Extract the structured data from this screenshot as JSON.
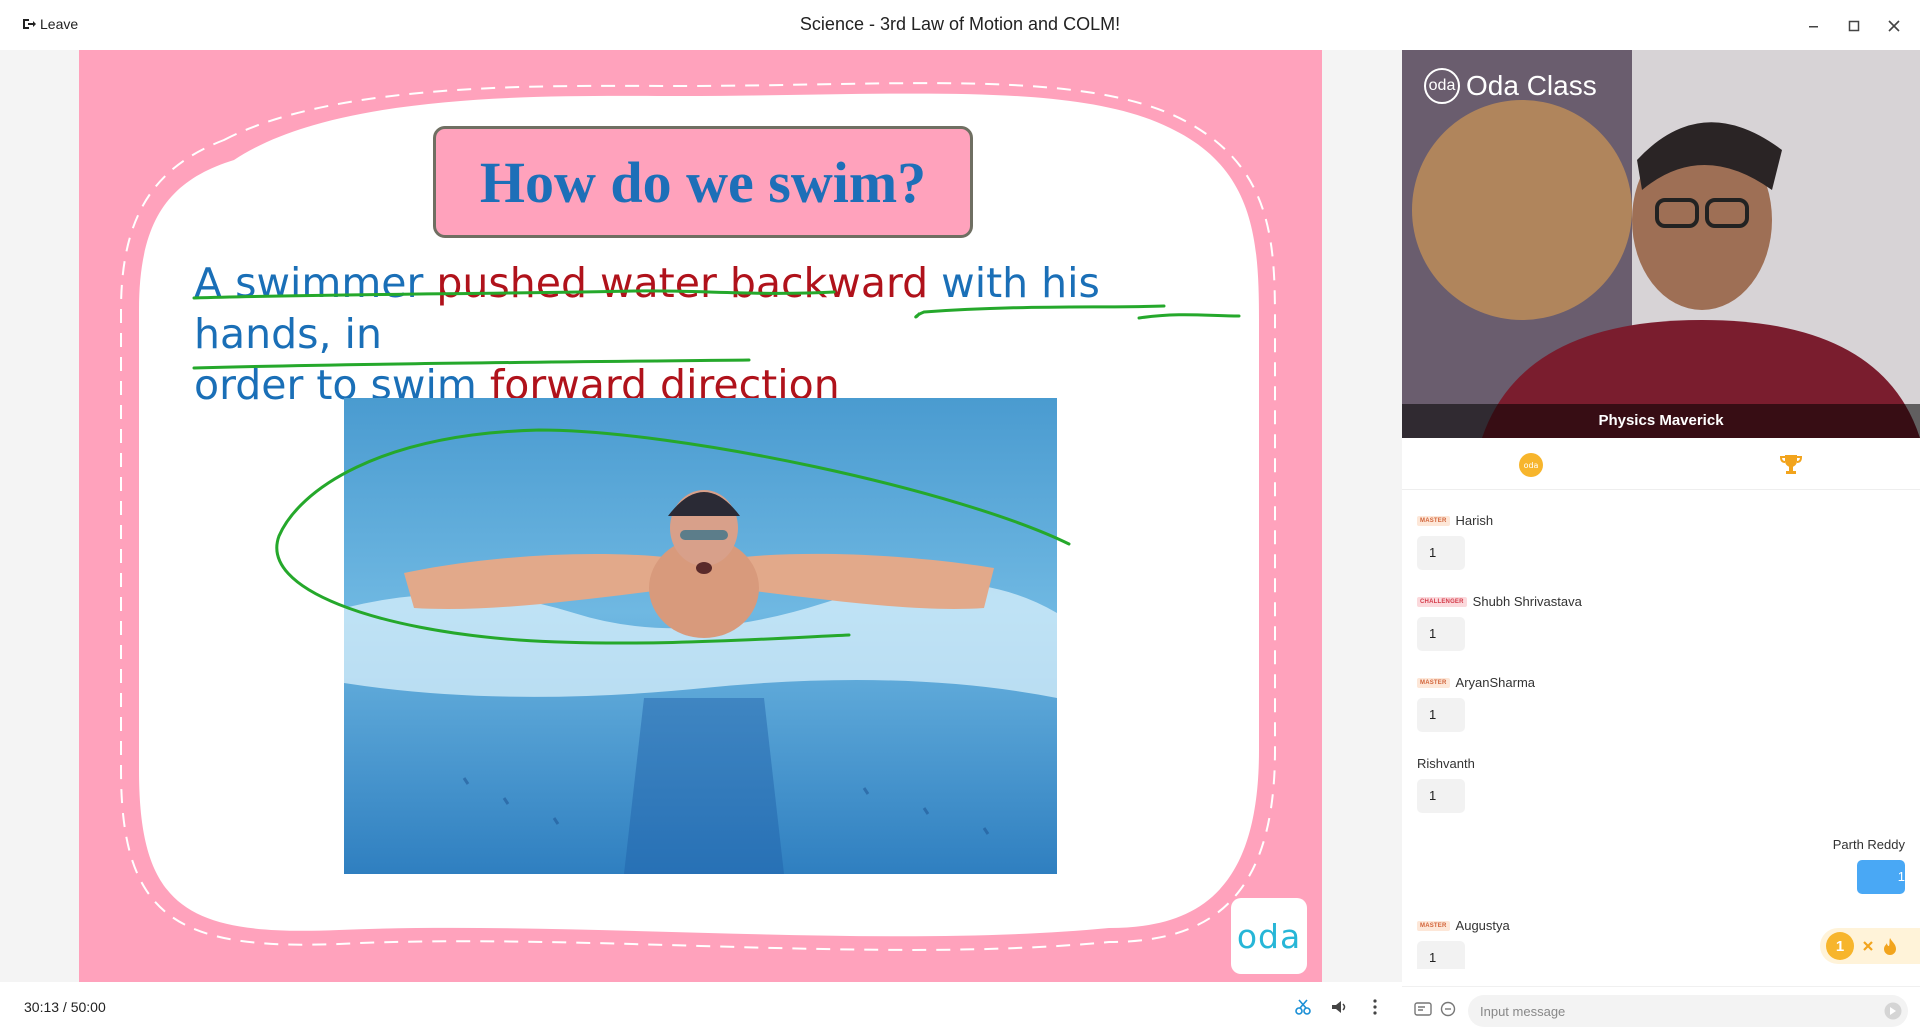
{
  "window": {
    "title": "Science - 3rd Law of Motion and COLM!",
    "leave_label": "Leave"
  },
  "slide": {
    "title": "How do we swim?",
    "body_segments": [
      {
        "text": "A ",
        "color": "#1a6fb7"
      },
      {
        "text": "swimmer ",
        "color": "#1a6fb7"
      },
      {
        "text": "pushed water backward ",
        "color": "#b0121b"
      },
      {
        "text": "with his hands, in",
        "color": "#1a6fb7"
      },
      {
        "text": "order to swim ",
        "color": "#1a6fb7"
      },
      {
        "text": "forward direction",
        "color": "#b0121b"
      }
    ],
    "badge_text": "oda",
    "ink_color": "#25a82b",
    "pink": "#ffa2bc"
  },
  "controls": {
    "timer": "30:13  / 50:00"
  },
  "video": {
    "brand": "Oda Class",
    "brand_mark": "oda",
    "presenter_name": "Physics Maverick"
  },
  "chat": {
    "messages": [
      {
        "rank": "MASTER",
        "name": "Harish",
        "text": "1"
      },
      {
        "rank": "CHALLENGER",
        "name": "Shubh Shrivastava",
        "text": "1"
      },
      {
        "rank": "MASTER",
        "name": "AryanSharma",
        "text": "1"
      },
      {
        "rank": "",
        "name": "Rishvanth",
        "text": "1"
      },
      {
        "rank": "",
        "name": "Parth Reddy",
        "text": "1",
        "own": true
      },
      {
        "rank": "MASTER",
        "name": "Augustya",
        "text": "1"
      }
    ],
    "reaction_count": "1",
    "input_placeholder": "Input message"
  }
}
